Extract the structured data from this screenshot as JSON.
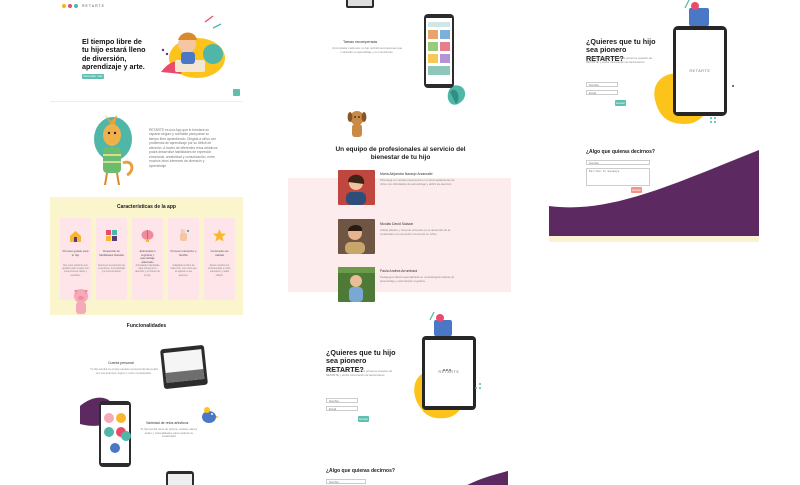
{
  "brand": {
    "name": "RETARTE",
    "dot_colors": [
      "#ffb300",
      "#e94c6b",
      "#4fb6a8",
      "#5b3a78"
    ]
  },
  "colors": {
    "accent_teal": "#5fbfb0",
    "accent_yellow": "#fcc31a",
    "band_yellow": "#fbf5cd",
    "band_pink": "#fdecee",
    "purple": "#5c2a61",
    "cream": "#fbf3d0"
  },
  "landing": {
    "hero": {
      "title": "El tiempo libre de tu hijo estará lleno de diversión, aprendizaje y arte.",
      "cta_label": "Descubre más",
      "chat_icon": "chat-icon"
    },
    "intro": {
      "text": "RETARTE es una App que le brindará un espacio seguro y confiable para pasar su tiempo libre aprendiendo. Dirigida a niños con problemas de aprendizaje por su déficit de atención. A través de diferentes retos artísticos podrá desarrollar habilidades de expresión emocional, creatividad y comunicación, entre muchos otros intereses de diversión y aprendizaje."
    },
    "features": {
      "title": "Características de la app",
      "cards": [
        {
          "icon": "house-icon",
          "label": "Proceso guiado para tu hijo",
          "text": "Sus retos artísticos son guiados paso a paso con instrucciones claras y sencillas."
        },
        {
          "icon": "puzzle-icon",
          "label": "Desarrollo de habilidades blandas",
          "text": "Favorece la expresión de emociones, la creatividad y la comunicación."
        },
        {
          "icon": "brain-icon",
          "label": "Estimulación cognitiva y aprendizaje adecuado",
          "text": "Actividades diseñadas para mantener la atención y el interés de tu hijo."
        },
        {
          "icon": "hand-icon",
          "label": "Proceso interactivo y flexible",
          "text": "Adaptado al ritmo de cada niño, con retos que se ajustan a sus avances."
        },
        {
          "icon": "star-icon",
          "label": "Contenidos de calidad",
          "text": "Retos creados por profesionales en arte, educación y salud infantil."
        }
      ]
    },
    "functionalities": {
      "title": "Funcionalidades",
      "items": [
        {
          "title": "Cuenta personal",
          "text": "Tu hijo tendrá su propio espacio personal donde podrá ver sus avances, logros y retos completados."
        },
        {
          "title": "Variedad de retos artísticos",
          "text": "Tu hijo tendrá retos de pintura, música, danza, teatro y manualidades para explorar su creatividad."
        }
      ]
    },
    "rewards": {
      "title": "Tareas recompensas",
      "text": "Al completar cada reto, tu hijo recibirá recompensas que motivarán su aprendizaje y su crecimiento."
    },
    "team": {
      "title": "Un equipo de profesionales al servicio del bienestar de tu hijo",
      "members": [
        {
          "name": "María Alejandra Naranjo Arzamalid",
          "bio": "Psicóloga con amplia experiencia en el acompañamiento de niños con dificultades de aprendizaje y déficit de atención.",
          "photo_color": "#c0473f"
        },
        {
          "name": "Nicolás David Salazar",
          "bio": "Artista plástico y docente enfocado en el desarrollo de la creatividad y la expresión emocional en niños.",
          "photo_color": "#6f5544"
        },
        {
          "name": "Paula Andrea Arrumbará",
          "bio": "Pedagoga infantil especializada en metodologías lúdicas de aprendizaje y estimulación cognitiva.",
          "photo_color": "#4d7a36"
        }
      ]
    },
    "signup": {
      "title": "¿Quieres que tu hijo sea pionero RETARTE?",
      "text": "Regístrate para ser parte de los primeros usuarios de RETARTE y recibe información de lanzamiento.",
      "name_placeholder": "Nombre",
      "email_placeholder": "Email",
      "send_label": "Enviar"
    },
    "contact": {
      "title": "¿Algo que quieras decirnos?",
      "name_placeholder": "Nombre",
      "message_placeholder": "Escribe tu mensaje",
      "send_label": "Enviar"
    }
  }
}
